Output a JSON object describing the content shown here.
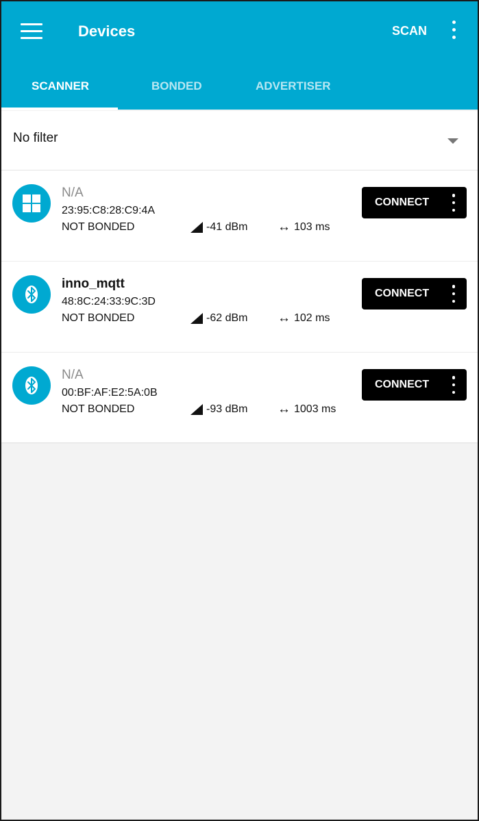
{
  "app": {
    "title": "Devices",
    "scan_label": "SCAN",
    "menu_icon": "hamburger-menu-icon",
    "more_icon": "more-vert-icon"
  },
  "tabs": [
    {
      "label": "SCANNER",
      "active": true
    },
    {
      "label": "BONDED",
      "active": false
    },
    {
      "label": "ADVERTISER",
      "active": false
    }
  ],
  "filter": {
    "label": "No filter",
    "caret_icon": "dropdown-caret-icon"
  },
  "devices": [
    {
      "name": "N/A",
      "mac": "23:95:C8:28:C9:4A",
      "bond": "NOT BONDED",
      "rssi": "-41 dBm",
      "interval": "103 ms",
      "icon": "windows-icon",
      "connect_label": "CONNECT"
    },
    {
      "name": "inno_mqtt",
      "mac": "48:8C:24:33:9C:3D",
      "bond": "NOT BONDED",
      "rssi": "-62 dBm",
      "interval": "102 ms",
      "icon": "bluetooth-icon",
      "connect_label": "CONNECT"
    },
    {
      "name": "N/A",
      "mac": "00:BF:AF:E2:5A:0B",
      "bond": "NOT BONDED",
      "rssi": "-93 dBm",
      "interval": "1003 ms",
      "icon": "bluetooth-icon",
      "connect_label": "CONNECT"
    }
  ],
  "colors": {
    "primary": "#00A9D1",
    "button": "#000000",
    "unnamed_text": "#8a8a8a",
    "empty_background": "#f3f3f3"
  }
}
